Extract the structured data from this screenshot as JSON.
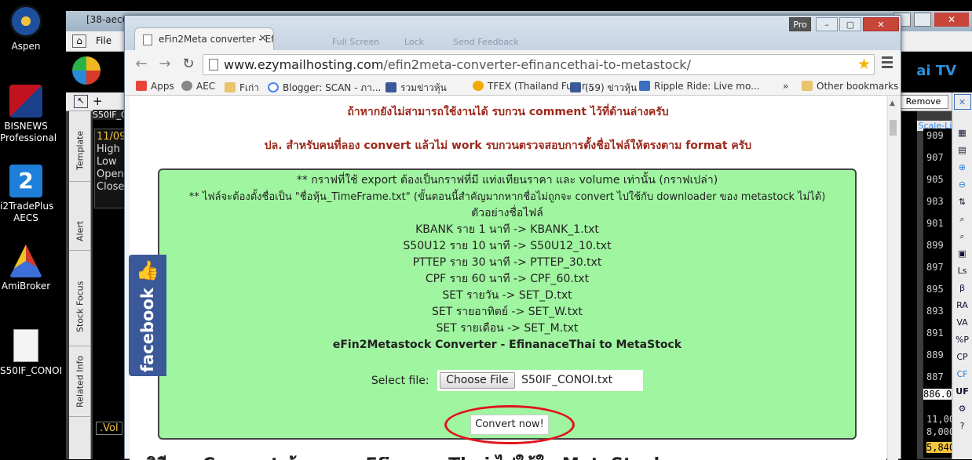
{
  "desktop": {
    "icons": [
      {
        "label": "Aspen",
        "color": "#1d4f9c"
      },
      {
        "label": "BISNEWS Professional",
        "color": "#c2121f"
      },
      {
        "label": "i2TradePlus AECS",
        "color": "#1e7fd8"
      },
      {
        "label": "AmiBroker",
        "color": "#d43a2a"
      },
      {
        "label": "S50IF_CONOI",
        "color": "#f4f4f4"
      }
    ]
  },
  "bg_app": {
    "title": "[38-aec6",
    "menu_file": "File",
    "symbol": "S50IF_C",
    "info": {
      "date": "11/09",
      "high": "High",
      "low": "Low",
      "open": "Open",
      "close": "Close"
    },
    "vol_label": ".Vol",
    "remove_button": "Remove",
    "scale_line": "Scale-Line",
    "tv_label": "ai TV",
    "vtabs": [
      "Template",
      "Alert",
      "Stock Focus",
      "Related Info"
    ],
    "price_ticks": [
      "909",
      "907",
      "905",
      "903",
      "901",
      "899",
      "897",
      "895",
      "893",
      "891",
      "889",
      "887",
      "886.00"
    ],
    "vol_ticks": [
      "11,00",
      "8,000",
      "5,840"
    ],
    "right_tools": [
      "β",
      "RA",
      "VA",
      "%P",
      "CP",
      "CF",
      "UF"
    ]
  },
  "chrome": {
    "tab_title": "eFin2Meta converter - Efi",
    "ghost_tabs": [
      "Full Screen",
      "Lock",
      "Send Feedback"
    ],
    "profile_button": "Pro",
    "url": {
      "host": "www.ezymailhosting.com",
      "path": "/efin2meta-converter-efinancethai-to-metastock/"
    },
    "bookmarks": [
      {
        "label": "Apps",
        "color": "#e8453c"
      },
      {
        "label": "AEC",
        "color": "#888888"
      },
      {
        "label": "Fเก่า",
        "color": "#e9c46a"
      },
      {
        "label": "Blogger: SCAN - ภา...",
        "color": "#4285f4"
      },
      {
        "label": "รวมข่าวหุ้น",
        "color": "#3b5998"
      },
      {
        "label": "TFEX (Thailand Futur...",
        "color": "#f2a900"
      },
      {
        "label": "(59) ข่าวหุ้น",
        "color": "#3b5998"
      },
      {
        "label": "Ripple Ride: Live mo...",
        "color": "#3a6fc1"
      }
    ],
    "bookmarks_more": "»",
    "other_bookmarks": "Other bookmarks"
  },
  "page": {
    "notice1": "ถ้าหากยังไม่สามารถใช้งานได้ รบกวน comment ไว้ที่ด้านล่างครับ",
    "notice2": "ปล. สำหรับคนที่ลอง convert แล้วไม่ work รบกวนตรวจสอบการตั้งชื่อไฟล์ให้ตรงตาม format ครับ",
    "lines": [
      "** กราฟที่ใช้ export ต้องเป็นกราฟที่มี แท่งเทียนราคา และ volume เท่านั้น (กราฟเปล่า)",
      "** ไฟล์จะต้องตั้งชื่อเป็น \"ชื่อหุ้น_TimeFrame.txt\" (ขั้นตอนนี้สำคัญมากหากชื่อไม่ถูกจะ convert ไปใช้กับ downloader ของ metastock ไม่ได้)",
      "ตัวอย่างชื่อไฟล์",
      "KBANK ราย 1 นาที -> KBANK_1.txt",
      "S50U12 ราย 10 นาที -> S50U12_10.txt",
      "PTTEP ราย 30 นาที -> PTTEP_30.txt",
      "CPF ราย 60 นาที -> CPF_60.txt",
      "SET รายวัน -> SET_D.txt",
      "SET รายอาทิตย์ -> SET_W.txt",
      "SET รายเดือน -> SET_M.txt"
    ],
    "converter_title": "eFin2Metastock Converter - EfinanaceThai to MetaStock",
    "select_label": "Select file:",
    "choose_button": "Choose File",
    "selected_file": "S50IF_CONOI.txt",
    "convert_button": "Convert now!",
    "heading_partial": "วิธีการ Convert ข้อมูลจาก EfinanceThai ไปใช้ใน MetaStock",
    "facebook_label": "facebook"
  }
}
